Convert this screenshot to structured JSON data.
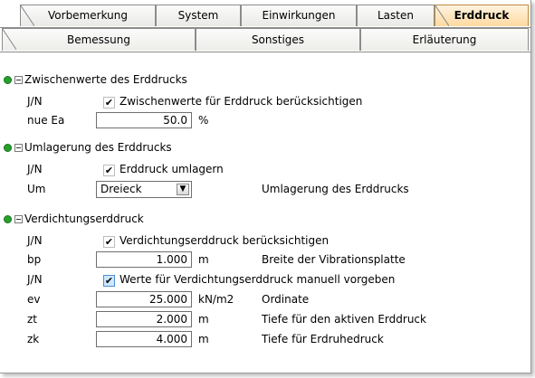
{
  "tabs_row1": [
    {
      "label": "Vorbemerkung",
      "active": false
    },
    {
      "label": "System",
      "active": false
    },
    {
      "label": "Einwirkungen",
      "active": false
    },
    {
      "label": "Lasten",
      "active": false
    },
    {
      "label": "Erddruck",
      "active": true
    }
  ],
  "tabs_row2": [
    {
      "label": "Bemessung"
    },
    {
      "label": "Sonstiges"
    },
    {
      "label": "Erläuterung"
    }
  ],
  "groups": {
    "g1": {
      "title": "Zwischenwerte des Erddrucks",
      "r1": {
        "label": "J/N",
        "check": "✔",
        "text": "Zwischenwerte für Erddruck berücksichtigen"
      },
      "r2": {
        "label": "nue Ea",
        "value": "50.0",
        "unit": "%"
      }
    },
    "g2": {
      "title": "Umlagerung des Erddrucks",
      "r1": {
        "label": "J/N",
        "check": "✔",
        "text": "Erddruck umlagern"
      },
      "r2": {
        "label": "Um",
        "value": "Dreieck",
        "desc": "Umlagerung des Erddrucks"
      }
    },
    "g3": {
      "title": "Verdichtungserddruck",
      "r1": {
        "label": "J/N",
        "check": "✔",
        "text": "Verdichtungserddruck berücksichtigen"
      },
      "r2": {
        "label": "bp",
        "value": "1.000",
        "unit": "m",
        "desc": "Breite der Vibrationsplatte"
      },
      "r3": {
        "label": "J/N",
        "check": "✔",
        "text": "Werte für Verdichtungserddruck manuell vorgeben"
      },
      "r4": {
        "label": "ev",
        "value": "25.000",
        "unit": "kN/m2",
        "desc": "Ordinate"
      },
      "r5": {
        "label": "zt",
        "value": "2.000",
        "unit": "m",
        "desc": "Tiefe für den aktiven Erddruck"
      },
      "r6": {
        "label": "zk",
        "value": "4.000",
        "unit": "m",
        "desc": "Tiefe für Erdruhedruck"
      }
    }
  },
  "icons": {
    "status_dot": "green-dot-icon",
    "collapse": "minus-box-icon",
    "dropdown": "chevron-down-icon"
  },
  "colors": {
    "active_tab": "#ffd9a0",
    "status_dot": "#26a02a",
    "check_highlight": "#cfe7ff"
  }
}
